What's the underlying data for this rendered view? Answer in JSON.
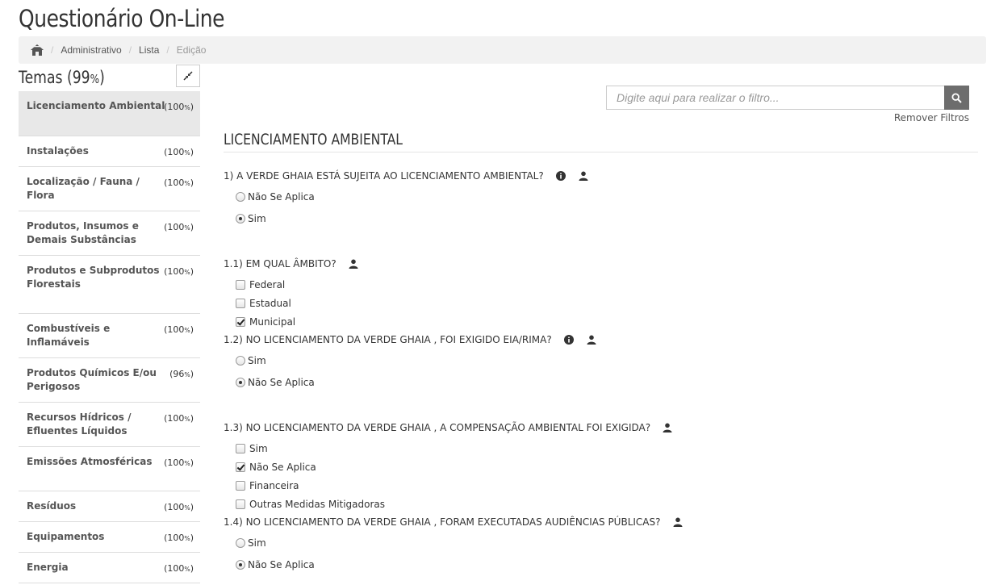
{
  "app": {
    "title": "Questionário On-Line"
  },
  "breadcrumb": {
    "home_icon": "home-icon",
    "items": [
      "Administrativo",
      "Lista"
    ],
    "current": "Edição"
  },
  "sidebar": {
    "title": "Temas",
    "overall": "(99%)",
    "collapse_icon": "compress-icon",
    "items": [
      {
        "label": "Licenciamento Ambiental",
        "pct": "(100%)"
      },
      {
        "label": "Instalações",
        "pct": "(100%)"
      },
      {
        "label": "Localização / Fauna / Flora",
        "pct": "(100%)"
      },
      {
        "label": "Produtos, Insumos e Demais Substâncias",
        "pct": "(100%)"
      },
      {
        "label": "Produtos e Subprodutos Florestais",
        "pct": "(100%)"
      },
      {
        "label": "Combustíveis e Inflamáveis",
        "pct": "(100%)"
      },
      {
        "label": "Produtos Químicos E/ou Perigosos",
        "pct": "(96%)"
      },
      {
        "label": "Recursos Hídricos / Efluentes Líquidos",
        "pct": "(100%)"
      },
      {
        "label": "Emissões Atmosféricas",
        "pct": "(100%)"
      },
      {
        "label": "Resíduos",
        "pct": "(100%)"
      },
      {
        "label": "Equipamentos",
        "pct": "(100%)"
      },
      {
        "label": "Energia",
        "pct": "(100%)"
      }
    ]
  },
  "filter": {
    "placeholder": "Digite aqui para realizar o filtro...",
    "remove_label": "Remover Filtros",
    "search_icon": "search-icon"
  },
  "section": {
    "title": "LICENCIAMENTO AMBIENTAL"
  },
  "questions": [
    {
      "text": "1) A VERDE GHAIA ESTÁ SUJEITA AO LICENCIAMENTO AMBIENTAL?",
      "type": "radio",
      "options": [
        {
          "label": "Não Se Aplica",
          "checked": false
        },
        {
          "label": "Sim",
          "checked": true
        }
      ]
    },
    {
      "text": "1.1) EM QUAL ÂMBITO?",
      "type": "checkbox",
      "options": [
        {
          "label": "Federal",
          "checked": false
        },
        {
          "label": "Estadual",
          "checked": false
        },
        {
          "label": "Municipal",
          "checked": true
        }
      ]
    },
    {
      "text": "1.2) NO LICENCIAMENTO DA VERDE GHAIA , FOI EXIGIDO EIA/RIMA?",
      "type": "radio",
      "options": [
        {
          "label": "Sim",
          "checked": false
        },
        {
          "label": "Não Se Aplica",
          "checked": true
        }
      ]
    },
    {
      "text": "1.3) NO LICENCIAMENTO DA VERDE GHAIA , A COMPENSAÇÃO AMBIENTAL FOI EXIGIDA?",
      "type": "checkbox",
      "options": [
        {
          "label": "Sim",
          "checked": false
        },
        {
          "label": "Não Se Aplica",
          "checked": true
        },
        {
          "label": "Financeira",
          "checked": false
        },
        {
          "label": "Outras Medidas Mitigadoras",
          "checked": false
        }
      ]
    },
    {
      "text": "1.4) NO LICENCIAMENTO DA VERDE GHAIA , FORAM EXECUTADAS AUDIÊNCIAS PÚBLICAS?",
      "type": "radio",
      "options": [
        {
          "label": "Sim",
          "checked": false
        },
        {
          "label": "Não Se Aplica",
          "checked": true
        }
      ]
    }
  ]
}
